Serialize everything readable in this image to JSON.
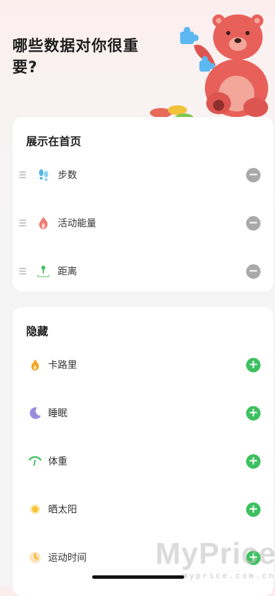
{
  "header": {
    "title": "哪些数据对你很重要?"
  },
  "shown_section": {
    "title": "展示在首页",
    "items": [
      {
        "label": "步数",
        "icon": "footprints-icon"
      },
      {
        "label": "活动能量",
        "icon": "flame-icon"
      },
      {
        "label": "距离",
        "icon": "distance-icon"
      }
    ],
    "action_icon": "remove-circle-icon"
  },
  "hidden_section": {
    "title": "隐藏",
    "items": [
      {
        "label": "卡路里",
        "icon": "calorie-icon"
      },
      {
        "label": "睡眠",
        "icon": "moon-icon"
      },
      {
        "label": "体重",
        "icon": "scale-icon"
      },
      {
        "label": "晒太阳",
        "icon": "sun-icon"
      },
      {
        "label": "运动时间",
        "icon": "clock-icon"
      }
    ],
    "action_icon": "add-circle-icon"
  },
  "watermark": {
    "logo": "MyPrice",
    "url": "myprice.com.cn"
  },
  "colors": {
    "add": "#3cc05f",
    "remove": "#a9a9a9",
    "bear": "#e8605a",
    "puzzle": "#5cb8f0"
  }
}
